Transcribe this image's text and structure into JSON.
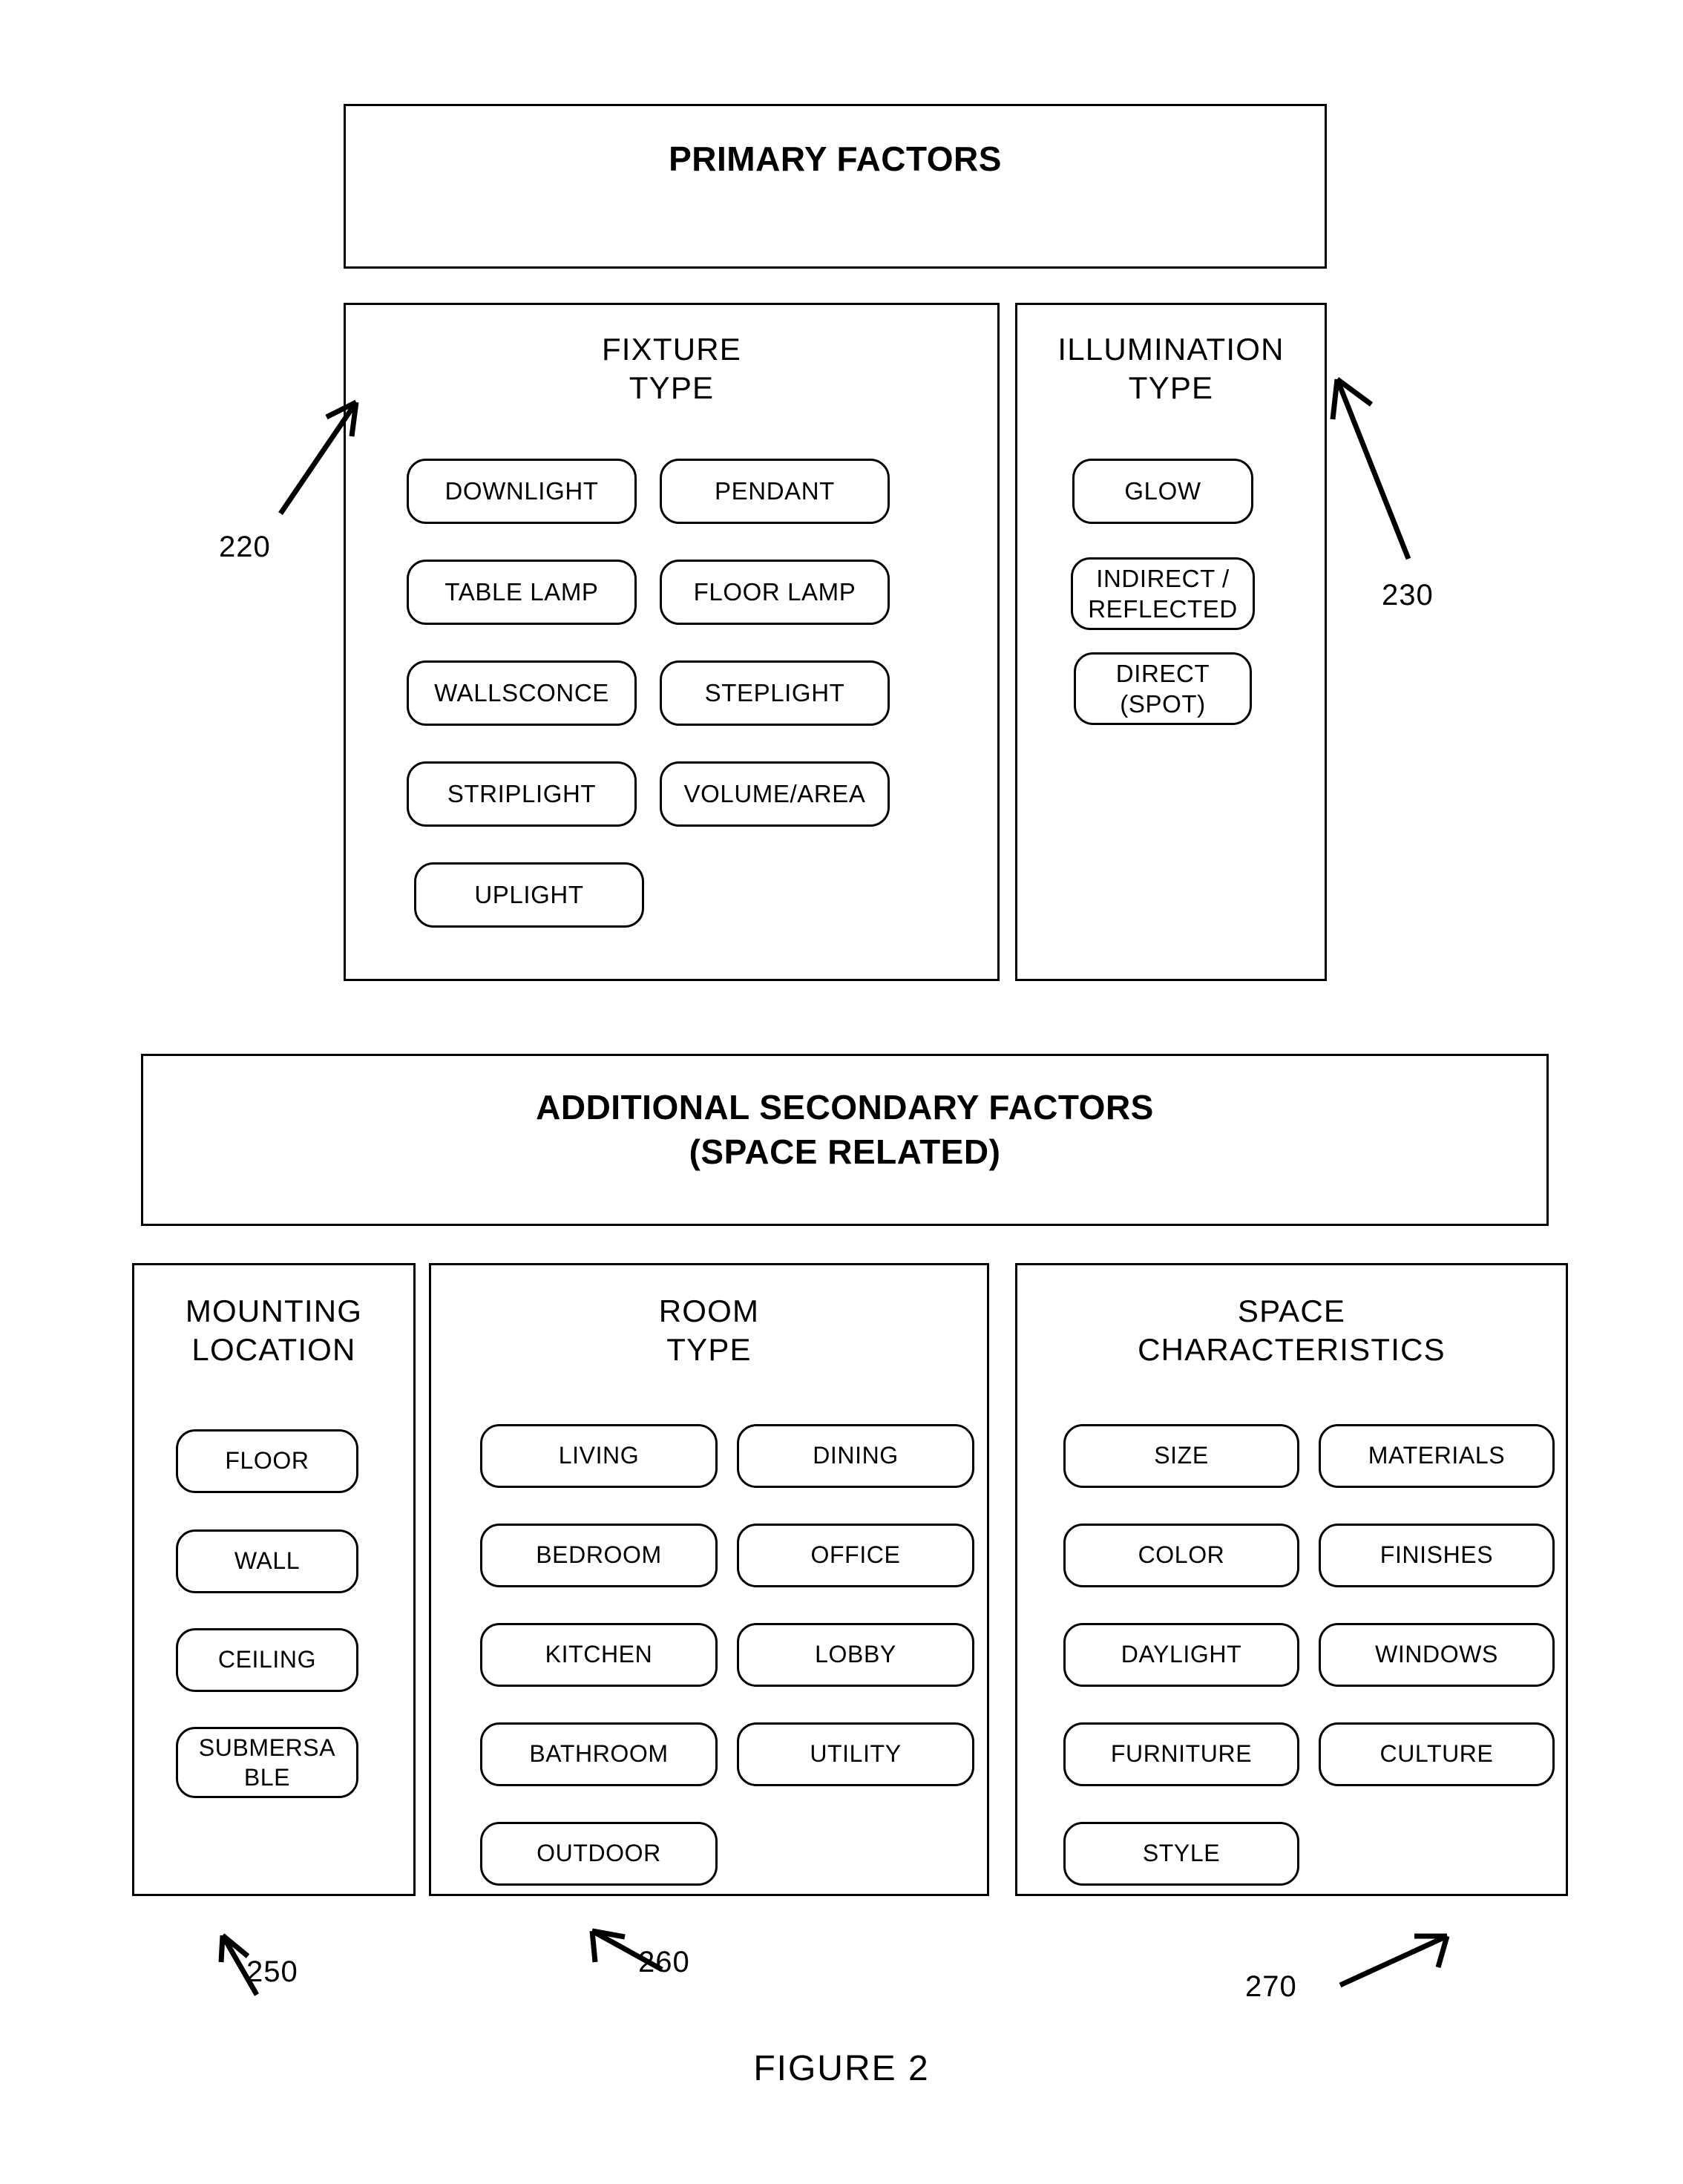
{
  "figure": {
    "caption": "FIGURE 2"
  },
  "primary": {
    "banner_title": "PRIMARY FACTORS",
    "groups": [
      {
        "ref": "220",
        "title_line1": "FIXTURE",
        "title_line2": "TYPE",
        "items": [
          "DOWNLIGHT",
          "PENDANT",
          "TABLE LAMP",
          "FLOOR LAMP",
          "WALLSCONCE",
          "STEPLIGHT",
          "STRIPLIGHT",
          "VOLUME/AREA",
          "UPLIGHT"
        ]
      },
      {
        "ref": "230",
        "title_line1": "ILLUMINATION",
        "title_line2": "TYPE",
        "items": [
          {
            "line1": "GLOW",
            "line2": ""
          },
          {
            "line1": "INDIRECT /",
            "line2": "REFLECTED"
          },
          {
            "line1": "DIRECT",
            "line2": "(SPOT)"
          }
        ]
      }
    ]
  },
  "secondary": {
    "banner_title_line1": "ADDITIONAL SECONDARY FACTORS",
    "banner_title_line2": "(SPACE RELATED)",
    "groups": [
      {
        "ref": "250",
        "title_line1": "MOUNTING",
        "title_line2": "LOCATION",
        "items": [
          {
            "line1": "FLOOR",
            "line2": ""
          },
          {
            "line1": "WALL",
            "line2": ""
          },
          {
            "line1": "CEILING",
            "line2": ""
          },
          {
            "line1": "SUBMERSA",
            "line2": "BLE"
          }
        ]
      },
      {
        "ref": "260",
        "title_line1": "ROOM",
        "title_line2": "TYPE",
        "items": [
          "LIVING",
          "DINING",
          "BEDROOM",
          "OFFICE",
          "KITCHEN",
          "LOBBY",
          "BATHROOM",
          "UTILITY",
          "OUTDOOR"
        ]
      },
      {
        "ref": "270",
        "title_line1": "SPACE",
        "title_line2": "CHARACTERISTICS",
        "items": [
          "SIZE",
          "MATERIALS",
          "COLOR",
          "FINISHES",
          "DAYLIGHT",
          "WINDOWS",
          "FURNITURE",
          "CULTURE",
          "STYLE"
        ]
      }
    ]
  },
  "colors": {
    "ink": "#000000",
    "paper": "#ffffff"
  }
}
